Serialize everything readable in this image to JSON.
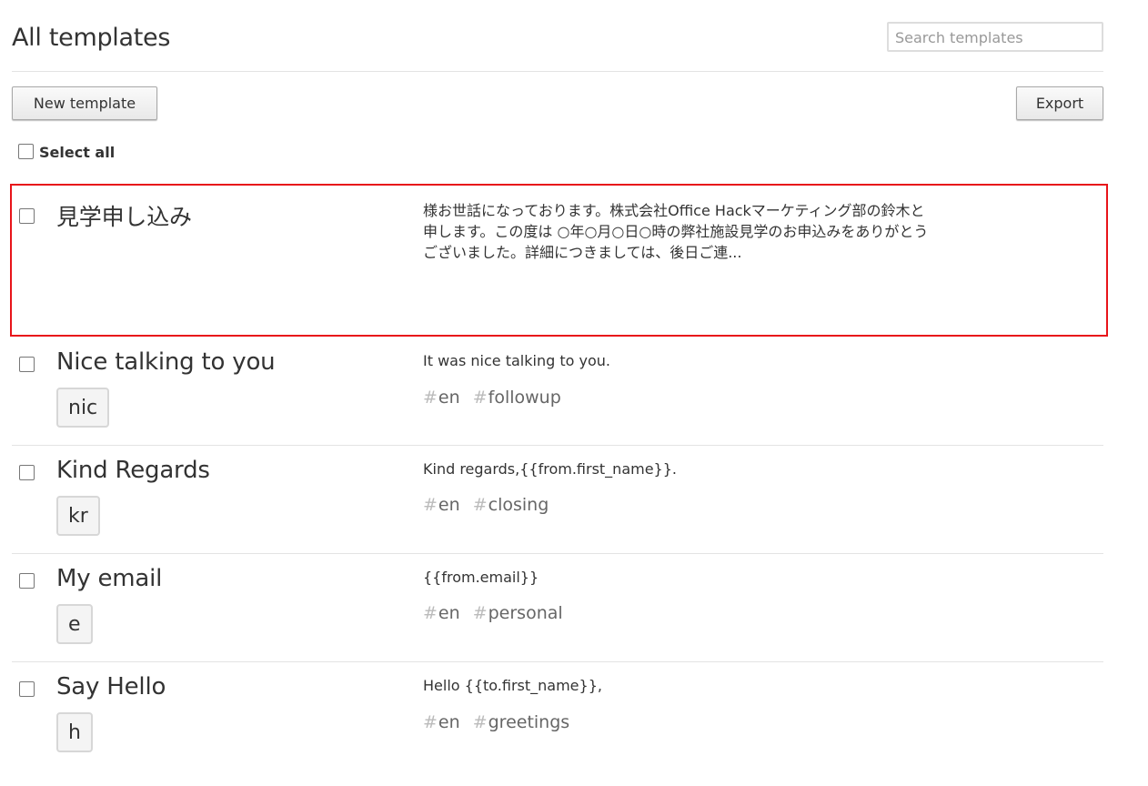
{
  "header": {
    "title": "All templates",
    "search_placeholder": "Search templates"
  },
  "toolbar": {
    "new_label": "New template",
    "export_label": "Export",
    "select_all_label": "Select all"
  },
  "templates": [
    {
      "title": "見学申し込み",
      "shortcut": "",
      "preview": "様お世話になっております。株式会社Office Hackマーケティング部の鈴木と申します。この度は ○年○月○日○時の弊社施設見学のお申込みをありがとうございました。詳細につきましては、後日ご連...",
      "tags": []
    },
    {
      "title": "Nice talking to you",
      "shortcut": "nic",
      "preview": "It was nice talking to you.",
      "tags": [
        "en",
        "followup"
      ]
    },
    {
      "title": "Kind Regards",
      "shortcut": "kr",
      "preview": "Kind regards,{{from.first_name}}.",
      "tags": [
        "en",
        "closing"
      ]
    },
    {
      "title": "My email",
      "shortcut": "e",
      "preview": "{{from.email}}",
      "tags": [
        "en",
        "personal"
      ]
    },
    {
      "title": "Say Hello",
      "shortcut": "h",
      "preview": "Hello {{to.first_name}},",
      "tags": [
        "en",
        "greetings"
      ]
    }
  ],
  "highlight_color": "#e8141a",
  "tag_symbol": "#"
}
